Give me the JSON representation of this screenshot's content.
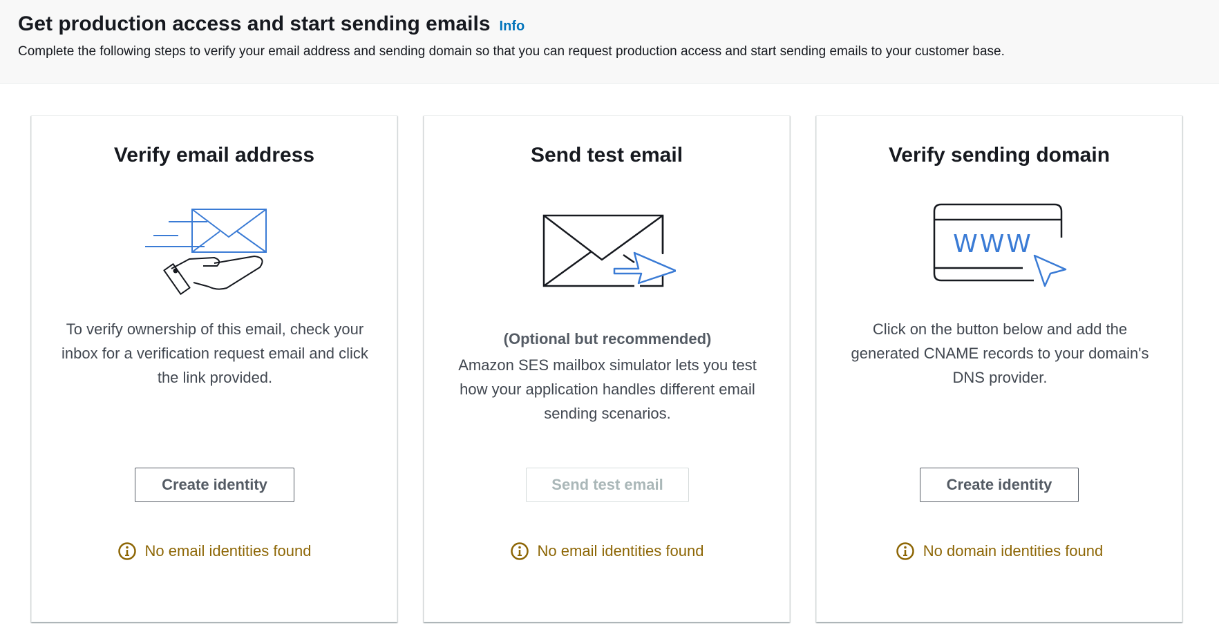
{
  "header": {
    "title": "Get production access and start sending emails",
    "info_link": "Info",
    "description": "Complete the following steps to verify your email address and sending domain so that you can request production access and start sending emails to your customer base."
  },
  "cards": [
    {
      "title": "Verify email address",
      "icon": "envelope-hand-icon",
      "description": "To verify ownership of this email, check your inbox for a verification request email and click the link provided.",
      "button_label": "Create identity",
      "status": "No email identities found"
    },
    {
      "title": "Send test email",
      "icon": "envelope-arrow-icon",
      "subtitle": "(Optional but recommended)",
      "description": "Amazon SES mailbox simulator lets you test how your application handles different email sending scenarios.",
      "button_label": "Send test email",
      "button_disabled": true,
      "status": "No email identities found"
    },
    {
      "title": "Verify sending domain",
      "icon": "browser-www-icon",
      "illustration_text": "WWW",
      "description": "Click on the button below and add the generated CNAME records to your domain's DNS provider.",
      "button_label": "Create identity",
      "status": "No domain identities found"
    }
  ],
  "colors": {
    "link": "#0073bb",
    "warning": "#8d6605",
    "illustration_accent": "#3a7bd5",
    "header_bg": "#f8f8f8"
  }
}
